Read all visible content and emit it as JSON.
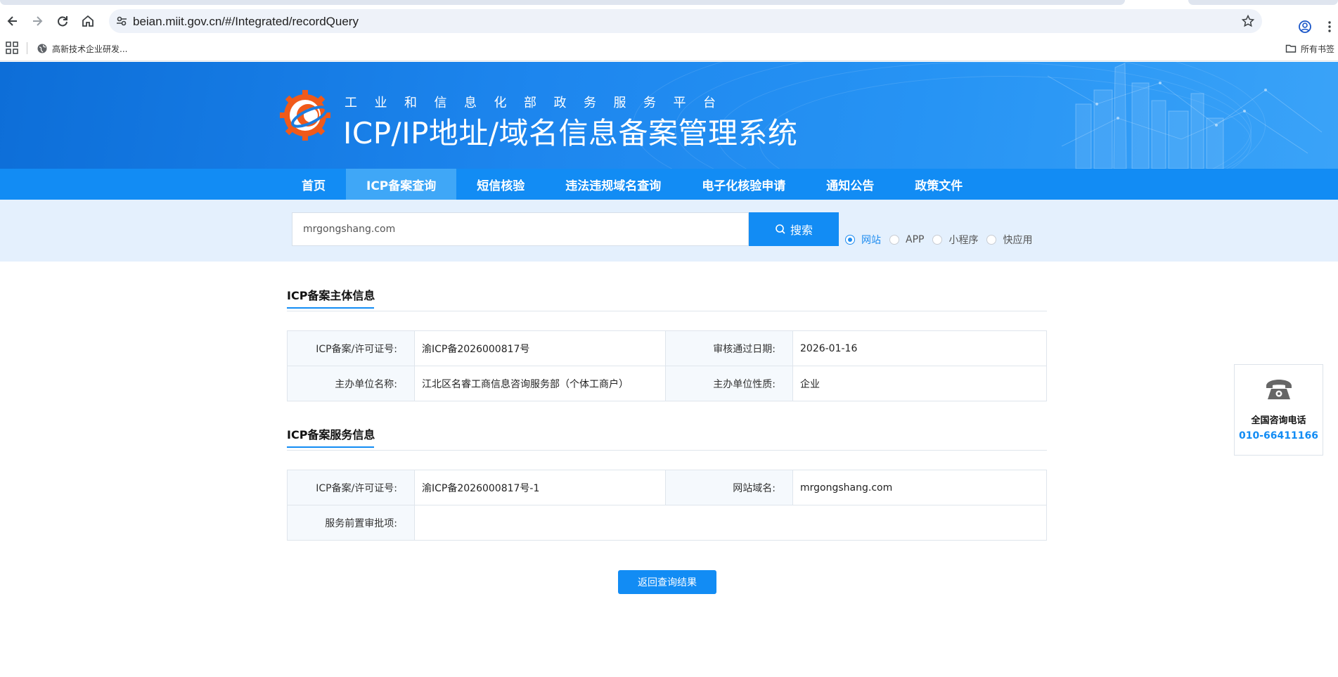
{
  "browser": {
    "url": "beian.miit.gov.cn/#/Integrated/recordQuery",
    "bookmark_item": "高新技术企业研发...",
    "bookmark_all": "所有书签"
  },
  "banner": {
    "subtitle": "工业和信息化部政务服务平台",
    "title": "ICP/IP地址/域名信息备案管理系统"
  },
  "nav": {
    "items": [
      "首页",
      "ICP备案查询",
      "短信核验",
      "违法违规域名查询",
      "电子化核验申请",
      "通知公告",
      "政策文件"
    ],
    "active_index": 1
  },
  "search": {
    "value": "mrgongshang.com",
    "button_label": "搜索",
    "options": [
      "网站",
      "APP",
      "小程序",
      "快应用"
    ],
    "selected": "网站"
  },
  "subject_section": {
    "title": "ICP备案主体信息",
    "rows": [
      {
        "label1": "ICP备案/许可证号:",
        "value1": "渝ICP备2026000817号",
        "label2": "审核通过日期:",
        "value2": "2026-01-16"
      },
      {
        "label1": "主办单位名称:",
        "value1": "江北区名睿工商信息咨询服务部（个体工商户）",
        "label2": "主办单位性质:",
        "value2": "企业"
      }
    ]
  },
  "service_section": {
    "title": "ICP备案服务信息",
    "row1": {
      "label1": "ICP备案/许可证号:",
      "value1": "渝ICP备2026000817号-1",
      "label2": "网站域名:",
      "value2": "mrgongshang.com"
    },
    "row2": {
      "label1": "服务前置审批项:",
      "value1": ""
    }
  },
  "back_button": "返回查询结果",
  "hotline": {
    "label": "全国咨询电话",
    "number": "010-66411166"
  },
  "colors": {
    "primary": "#128cf4",
    "nav_active": "#3fa7f7",
    "search_band": "#e4f0fd"
  }
}
